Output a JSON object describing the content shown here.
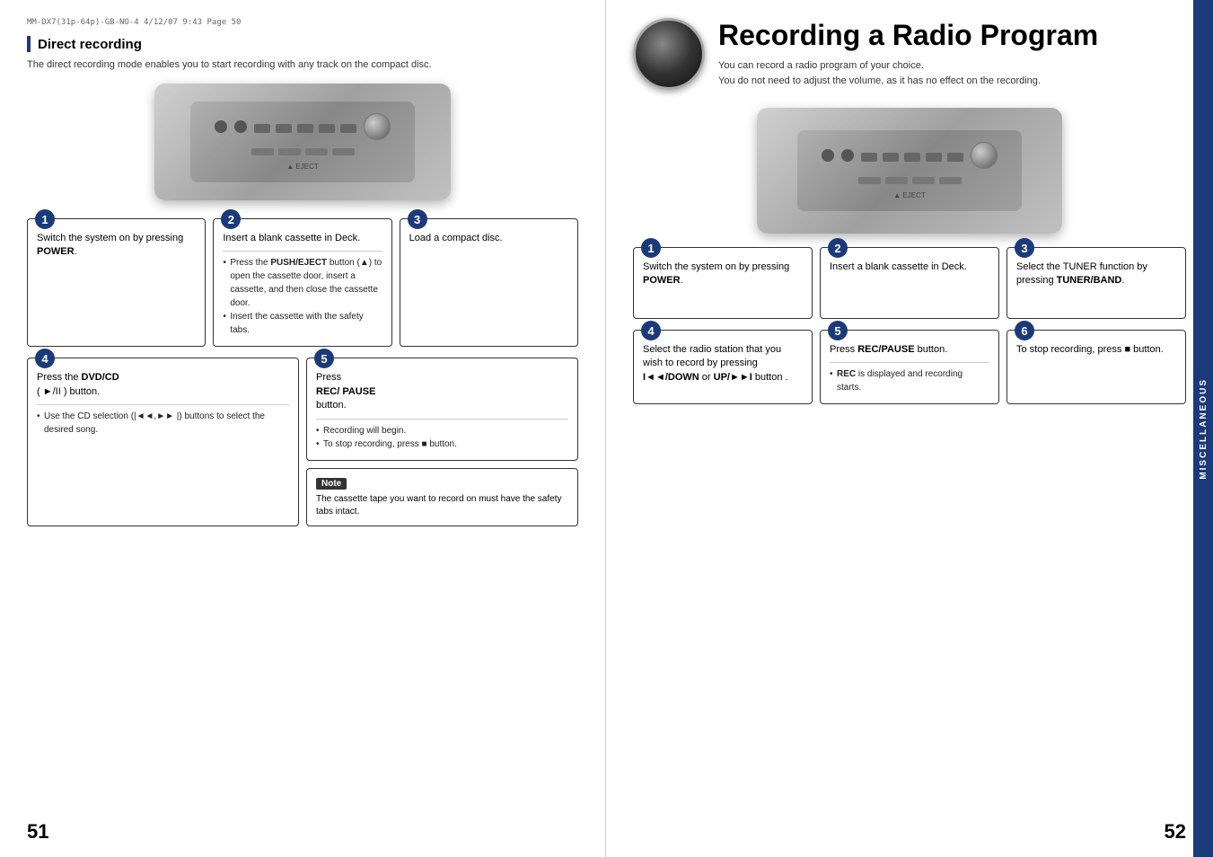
{
  "header_bar": "MM-DX7(31p-64p)-GB-NO-4   4/12/07   9:43   Page 50",
  "right_title": "Recording a Radio Program",
  "right_subtitle_1": "You can record a radio program of your choice.",
  "right_subtitle_2": "You do not need to adjust the volume, as it has no effect on the recording.",
  "left_section_title": "Direct recording",
  "left_section_desc": "The direct recording mode enables you to start recording with any track on the compact disc.",
  "left_steps": [
    {
      "number": "1",
      "text": "Switch the system on by pressing POWER."
    },
    {
      "number": "2",
      "text": "Insert a blank cassette in Deck.",
      "bullets": [
        "Press the PUSH/EJECT button (▲) to open the cassette door, insert a cassette, and then close the cassette door.",
        "Insert the cassette with the safety tabs."
      ]
    },
    {
      "number": "3",
      "text": "Load a compact disc."
    },
    {
      "number": "4",
      "text": "Press the DVD/CD ( ►/II ) button.",
      "bullets": [
        "Use the CD selection (|◄◄,►►|) buttons to select the desired song."
      ]
    },
    {
      "number": "5",
      "text": "Press REC/ PAUSE button.",
      "bullets": [
        "Recording will begin.",
        "To stop recording, press ■ button."
      ]
    }
  ],
  "note_label": "Note",
  "note_text": "The cassette tape you want to record on must have the safety tabs intact.",
  "right_steps": [
    {
      "number": "1",
      "text": "Switch the system on by pressing POWER."
    },
    {
      "number": "2",
      "text": "Insert a blank cassette in Deck."
    },
    {
      "number": "3",
      "text": "Select the TUNER function by pressing TUNER/BAND."
    },
    {
      "number": "4",
      "text": "Select the radio station that you wish to record by pressing I◄◄/DOWN or UP/►►I button ."
    },
    {
      "number": "5",
      "text": "Press REC/PAUSE button.",
      "bullets": [
        "REC is displayed  and recording starts."
      ]
    },
    {
      "number": "6",
      "text": "To stop recording, press ■ button."
    }
  ],
  "page_left": "51",
  "page_right": "52",
  "misc_label": "MISCELLANEOUS"
}
